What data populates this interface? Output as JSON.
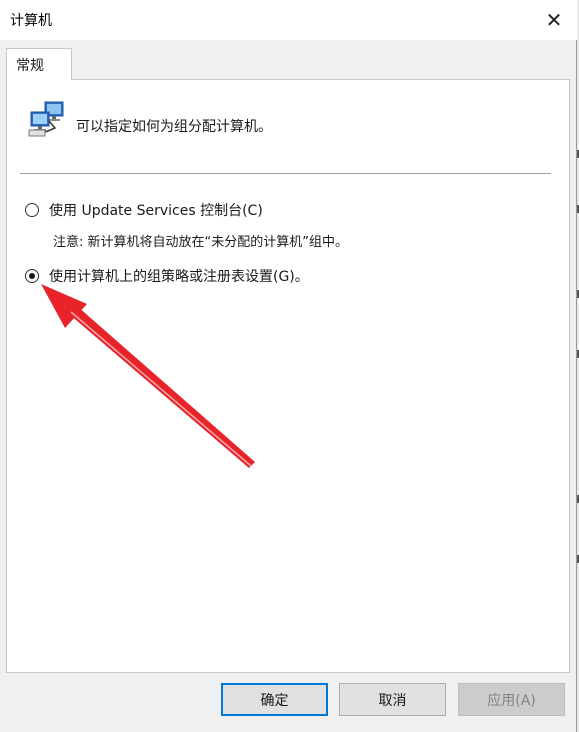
{
  "window": {
    "title": "计算机",
    "close_glyph": "✕"
  },
  "tabs": [
    {
      "label": "常规",
      "selected": true
    }
  ],
  "header": {
    "icon": "network-computers-icon",
    "description": "可以指定如何为组分配计算机。"
  },
  "options": [
    {
      "label": "使用 Update Services 控制台(C)",
      "checked": false
    },
    {
      "label": "使用计算机上的组策略或注册表设置(G)。",
      "checked": true
    }
  ],
  "note": "注意: 新计算机将自动放在“未分配的计算机”组中。",
  "buttons": {
    "ok": "确定",
    "cancel": "取消",
    "apply": "应用(A)"
  },
  "colors": {
    "accent": "#0078d7",
    "arrow": "#e8232a"
  }
}
